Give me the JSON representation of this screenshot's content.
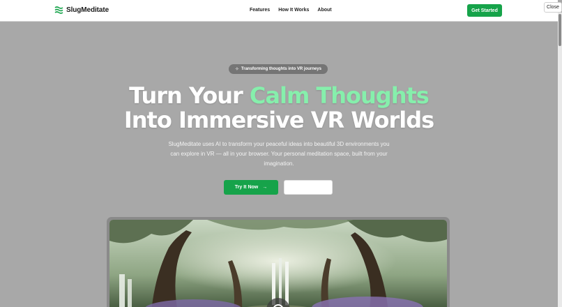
{
  "navbar": {
    "brand": "SlugMeditate",
    "links": [
      "Features",
      "How It Works",
      "About"
    ],
    "cta": "Get Started"
  },
  "overlay": {
    "close_label": "Close"
  },
  "hero": {
    "badge": "Transforming thoughts into VR journeys",
    "headline_part1": "Turn Your ",
    "headline_accent": "Calm Thoughts",
    "headline_line2": "Into Immersive VR Worlds",
    "subtitle": "SlugMeditate uses AI to transform your peaceful ideas into beautiful 3D environments you can explore in VR — all in your browser. Your personal meditation space, built from your imagination.",
    "primary_button": "Try It Now",
    "secondary_button": ""
  },
  "icons": {
    "brand": "waves-icon",
    "badge": "sparkle-icon",
    "primary_button": "arrow-right-icon",
    "preview": "play-icon"
  },
  "colors": {
    "accent_green": "#16a34a",
    "highlight_green": "#86efac",
    "backdrop": "#a8a8a8"
  }
}
